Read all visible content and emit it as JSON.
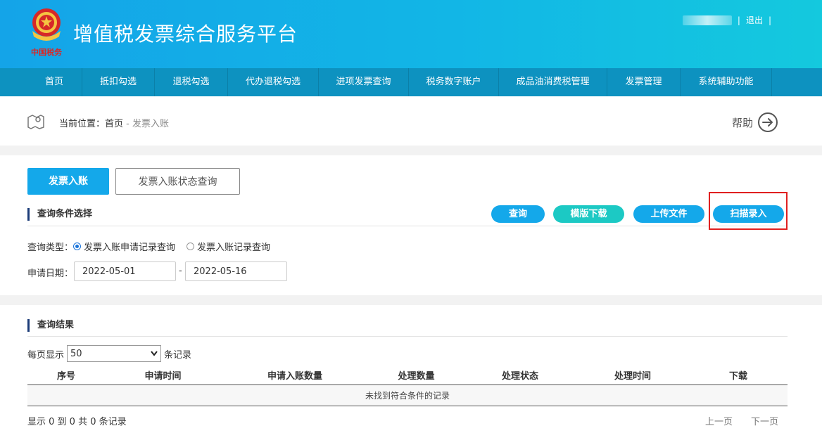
{
  "header": {
    "emblem_caption": "中国税务",
    "title": "增值税发票综合服务平台",
    "separator": "|",
    "logout_label": "退出"
  },
  "nav": {
    "items": [
      {
        "label": "首页"
      },
      {
        "label": "抵扣勾选"
      },
      {
        "label": "退税勾选"
      },
      {
        "label": "代办退税勾选"
      },
      {
        "label": "进项发票查询"
      },
      {
        "label": "税务数字账户"
      },
      {
        "label": "成品油消费税管理"
      },
      {
        "label": "发票管理"
      },
      {
        "label": "系统辅助功能"
      }
    ]
  },
  "breadcrumb": {
    "prefix": "当前位置：",
    "home": "首页",
    "separator": " - ",
    "current": "发票入账"
  },
  "help": {
    "label": "帮助"
  },
  "tabs": {
    "active": "发票入账",
    "inactive": "发票入账状态查询"
  },
  "query_section": {
    "title": "查询条件选择",
    "buttons": {
      "query": "查询",
      "template_download": "模版下载",
      "upload_file": "上传文件",
      "scan_entry": "扫描录入"
    },
    "query_type_label": "查询类型：",
    "radio_options": [
      {
        "label": "发票入账申请记录查询",
        "checked": true
      },
      {
        "label": "发票入账记录查询",
        "checked": false
      }
    ],
    "date_label": "申请日期：",
    "date_start": "2022-05-01",
    "date_separator": "-",
    "date_end": "2022-05-16"
  },
  "results_section": {
    "title": "查询结果",
    "page_size_prefix": "每页显示",
    "page_size_value": "50",
    "page_size_suffix": "条记录",
    "columns": [
      "序号",
      "申请时间",
      "申请入账数量",
      "处理数量",
      "处理状态",
      "处理时间",
      "下载"
    ],
    "empty_message": "未找到符合条件的记录",
    "footer_info": "显示 0 到 0 共 0 条记录",
    "prev_label": "上一页",
    "next_label": "下一页"
  },
  "colors": {
    "header_start": "#14a4e8",
    "nav_bg": "#0d92c0",
    "primary_button": "#14a8ea",
    "teal_button": "#1cc9c4",
    "highlight_border": "#e02020",
    "section_marker": "#1b3c78"
  }
}
